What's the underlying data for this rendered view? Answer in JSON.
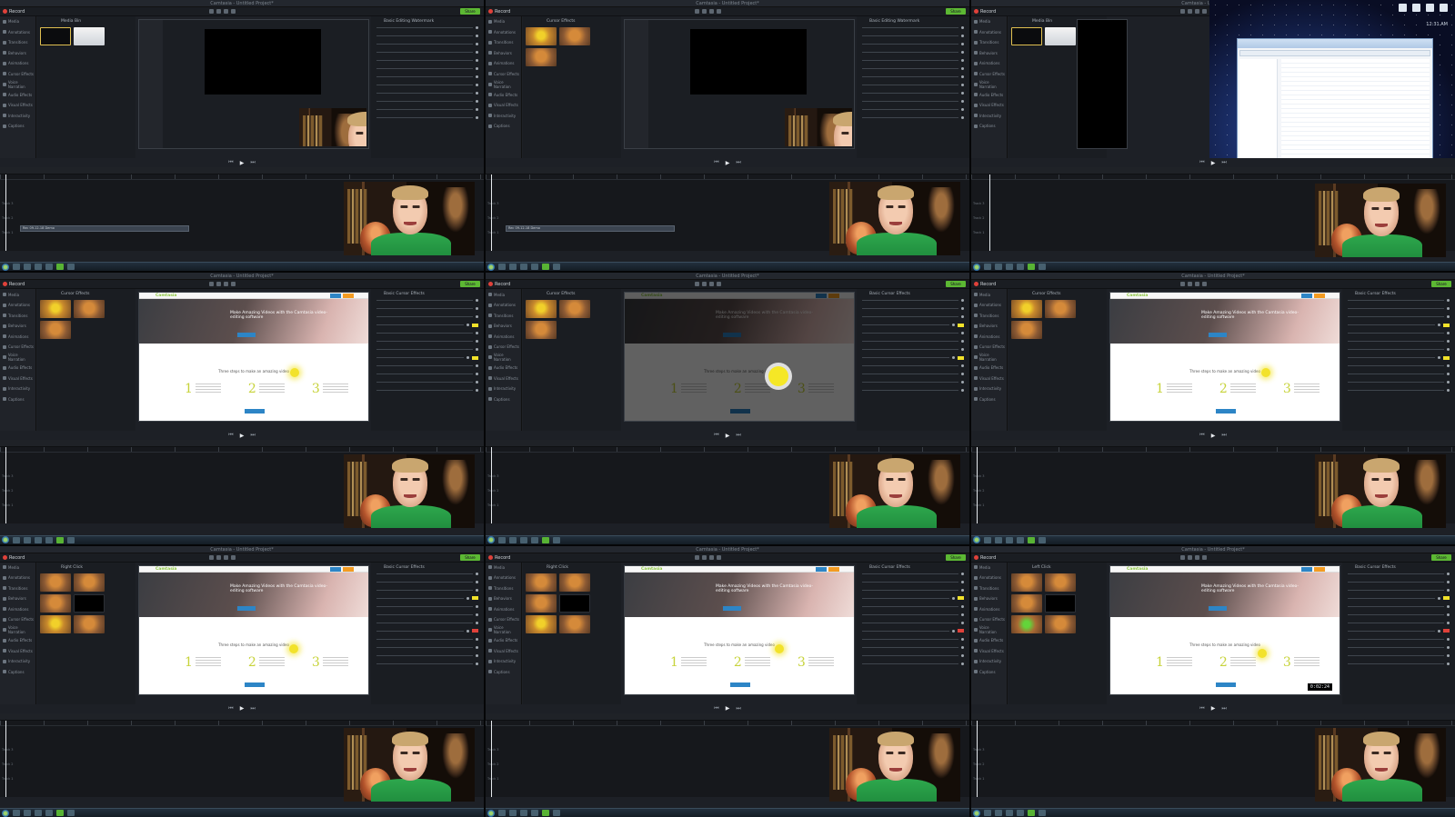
{
  "app": {
    "window_title": "Camtasia - Untitled Project*",
    "record_label": "Record",
    "share_label": "Share"
  },
  "sidebar_items": [
    "Media",
    "Annotations",
    "Transitions",
    "Behaviors",
    "Animations",
    "Cursor Effects",
    "Voice Narration",
    "Audio Effects",
    "Visual Effects",
    "Interactivity",
    "Captions"
  ],
  "frames": [
    {
      "kind": "editor-nested",
      "library_title": "Media Bin",
      "props_title": "Basic Editing Watermark",
      "canvas": "nested",
      "thumbs": [
        "t-dark",
        "t-white"
      ]
    },
    {
      "kind": "editor-nested",
      "library_title": "Cursor Effects",
      "props_title": "Basic Editing Watermark",
      "canvas": "nested",
      "thumbs": [
        "t-yellow",
        "t-orange",
        "t-orange"
      ]
    },
    {
      "kind": "desktop",
      "library_title": "Media Bin",
      "props_title": "",
      "canvas": "black",
      "thumbs": [
        "t-dark",
        "t-white"
      ]
    },
    {
      "kind": "editor-web",
      "library_title": "Cursor Effects",
      "props_title": "Basic Cursor Effects",
      "canvas": "web",
      "thumbs": [
        "t-yellow",
        "t-orange",
        "t-orange"
      ]
    },
    {
      "kind": "editor-web-dim",
      "library_title": "Cursor Effects",
      "props_title": "Basic Cursor Effects",
      "canvas": "web-dim",
      "thumbs": [
        "t-yellow",
        "t-orange",
        "t-orange"
      ]
    },
    {
      "kind": "editor-web",
      "library_title": "Cursor Effects",
      "props_title": "Basic Cursor Effects",
      "canvas": "web",
      "thumbs": [
        "t-yellow",
        "t-orange",
        "t-orange"
      ]
    },
    {
      "kind": "editor-web",
      "library_title": "Right Click",
      "props_title": "Basic Cursor Effects",
      "canvas": "web",
      "thumbs": [
        "t-orange",
        "t-orange",
        "t-orange",
        "t-black",
        "t-yellow",
        "t-orange"
      ]
    },
    {
      "kind": "editor-web",
      "library_title": "Right Click",
      "props_title": "Basic Cursor Effects",
      "canvas": "web",
      "thumbs": [
        "t-orange",
        "t-orange",
        "t-orange",
        "t-black",
        "t-yellow",
        "t-orange"
      ]
    },
    {
      "kind": "editor-web-timecode",
      "library_title": "Left Click",
      "props_title": "Basic Cursor Effects",
      "canvas": "web",
      "thumbs": [
        "t-orange",
        "t-orange",
        "t-orange",
        "t-black",
        "t-green",
        "t-orange"
      ]
    }
  ],
  "web_page": {
    "logo": "Camtasia",
    "headline": "Make Amazing Videos with the Camtasia video-editing software",
    "sub": "Three steps to make an amazing video"
  },
  "timeline": {
    "clip_label": "Rec 09-12-18 Demo",
    "track_labels": [
      "Track 3",
      "Track 2",
      "Track 1"
    ]
  },
  "overlay_timecode": "0:02:24",
  "desktop": {
    "clock": "12:31 AM"
  },
  "colors": {
    "accent_green": "#5cb833",
    "record_red": "#e0413a",
    "web_number_yellow": "#c7d33b",
    "cursor_highlight": "#f2e22a",
    "shirt_green": "#2ea84d"
  },
  "icons": [
    "record-icon",
    "play-icon",
    "rewind-icon",
    "forward-icon",
    "start-icon"
  ]
}
